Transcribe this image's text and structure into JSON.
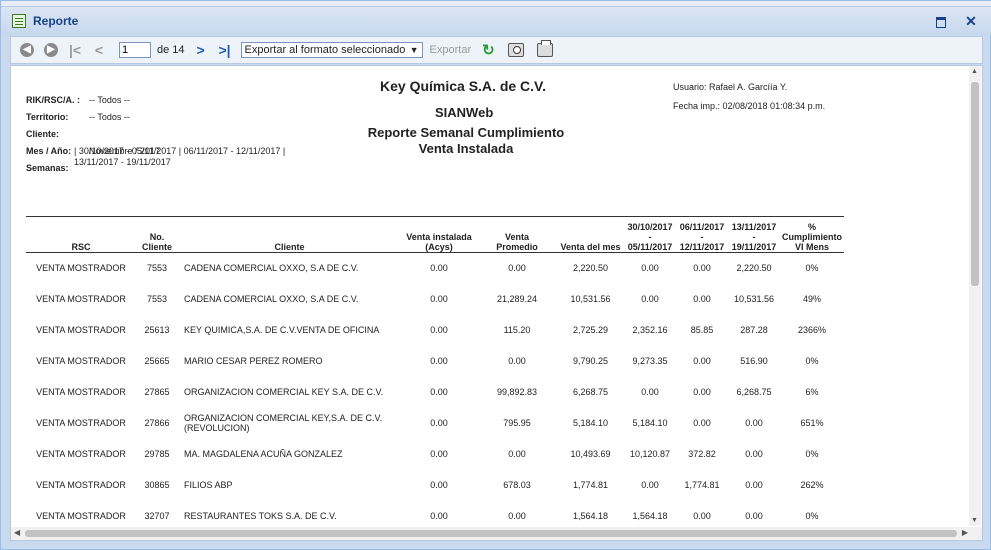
{
  "window": {
    "title": "Reporte"
  },
  "toolbar": {
    "page_value": "1",
    "page_of": "de 14",
    "export_format": "Exportar al formato seleccionado",
    "export_label": "Exportar"
  },
  "report": {
    "company": "Key Química S.A. de C.V.",
    "system": "SIANWeb",
    "title_line1": "Reporte Semanal Cumplimiento",
    "title_line2": "Venta Instalada",
    "user": "Usuario: Rafael A. Garcíía Y.",
    "print_date": "Fecha imp.: 02/08/2018 01:08:34 p.m.",
    "filters": [
      {
        "label": "RIK/RSC/A. :",
        "value": "-- Todos --"
      },
      {
        "label": "Territorio:",
        "value": "-- Todos --"
      },
      {
        "label": "Cliente:",
        "value": ""
      },
      {
        "label": "Mes / Año:",
        "value": "Noviembre / 2017"
      },
      {
        "label": "Semanas:",
        "value": ""
      }
    ],
    "semanas_value": "   | 30/10/2017 - 05/11/2017 | 06/11/2017 - 12/11/2017 |\n13/11/2017 - 19/11/2017"
  },
  "table": {
    "headers": [
      "RSC",
      "No.\nCliente",
      "Cliente",
      "Venta instalada\n(Acys)",
      "Venta\nPromedio",
      "Venta del mes",
      "30/10/2017\n-\n05/11/2017",
      "06/11/2017\n-\n12/11/2017",
      "13/11/2017\n-\n19/11/2017",
      "%\nCumplimiento\nVI Mens"
    ],
    "rows": [
      [
        "VENTA MOSTRADOR",
        "7553",
        "CADENA COMERCIAL OXXO, S.A DE C.V.",
        "0.00",
        "0.00",
        "2,220.50",
        "0.00",
        "0.00",
        "2,220.50",
        "0%"
      ],
      [
        "VENTA MOSTRADOR",
        "7553",
        "CADENA COMERCIAL OXXO, S.A DE C.V.",
        "0.00",
        "21,289.24",
        "10,531.56",
        "0.00",
        "0.00",
        "10,531.56",
        "49%"
      ],
      [
        "VENTA MOSTRADOR",
        "25613",
        "KEY QUIMICA,S.A. DE C.V.VENTA DE OFICINA",
        "0.00",
        "115.20",
        "2,725.29",
        "2,352.16",
        "85.85",
        "287.28",
        "2366%"
      ],
      [
        "VENTA MOSTRADOR",
        "25665",
        "MARIO CESAR PEREZ ROMERO",
        "0.00",
        "0.00",
        "9,790.25",
        "9,273.35",
        "0.00",
        "516.90",
        "0%"
      ],
      [
        "VENTA MOSTRADOR",
        "27865",
        "ORGANIZACION COMERCIAL KEY S.A. DE C.V.",
        "0.00",
        "99,892.83",
        "6,268.75",
        "0.00",
        "0.00",
        "6,268.75",
        "6%"
      ],
      [
        "VENTA MOSTRADOR",
        "27866",
        "ORGANIZACION COMERCIAL KEY,S.A. DE C.V. (REVOLUCION)",
        "0.00",
        "795.95",
        "5,184.10",
        "5,184.10",
        "0.00",
        "0.00",
        "651%"
      ],
      [
        "VENTA MOSTRADOR",
        "29785",
        "MA. MAGDALENA ACUÑA GONZALEZ",
        "0.00",
        "0.00",
        "10,493.69",
        "10,120.87",
        "372.82",
        "0.00",
        "0%"
      ],
      [
        "VENTA MOSTRADOR",
        "30865",
        "FILIOS ABP",
        "0.00",
        "678.03",
        "1,774.81",
        "0.00",
        "1,774.81",
        "0.00",
        "262%"
      ],
      [
        "VENTA MOSTRADOR",
        "32707",
        "RESTAURANTES TOKS  S.A. DE C.V.",
        "0.00",
        "0.00",
        "1,564.18",
        "1,564.18",
        "0.00",
        "0.00",
        "0%"
      ]
    ]
  }
}
